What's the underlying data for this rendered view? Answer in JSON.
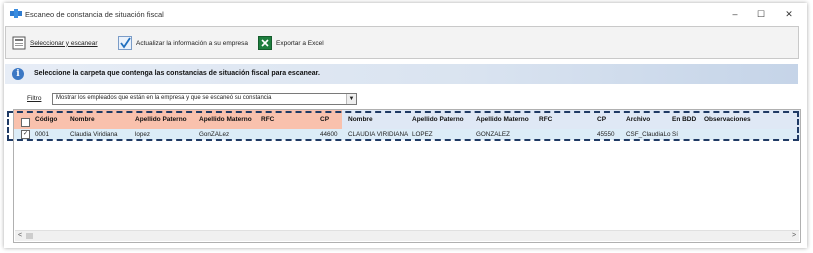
{
  "window": {
    "title": "Escaneo de constancia de situación fiscal",
    "controls": {
      "minimize": "–",
      "maximize": "☐",
      "close": "✕"
    }
  },
  "toolbar": {
    "scan_label": "Seleccionar y escanear",
    "update_label": "Actualizar la información a su empresa",
    "export_label": "Exportar a Excel"
  },
  "info": {
    "text": "Seleccione la carpeta que contenga las constancias de situación fiscal para escanear."
  },
  "filter": {
    "label": "Filtro",
    "value": "Mostrar los empleados que están en la empresa y que se escaneó su constancia"
  },
  "grid": {
    "left_headers": {
      "codigo": "Código",
      "nombre": "Nombre",
      "paterno": "Apellido Paterno",
      "materno": "Apellido Materno",
      "rfc": "RFC",
      "cp": "CP"
    },
    "right_headers": {
      "nombre": "Nombre",
      "paterno": "Apellido Paterno",
      "materno": "Apellido Materno",
      "rfc": "RFC",
      "cp": "CP",
      "archivo": "Archivo",
      "en_bdd": "En BDD",
      "observaciones": "Observaciones"
    },
    "row": {
      "checked": "✓",
      "codigo": "0001",
      "nombre": "Claudia Viridiana",
      "paterno": "lopez",
      "materno": "GonZALez",
      "rfc": "",
      "cp": "44600",
      "scan_nombre": "CLAUDIA VIRIDIANA",
      "scan_paterno": "LOPEZ",
      "scan_materno": "GONZALEZ",
      "scan_rfc": "",
      "scan_cp": "45550",
      "archivo": "CSF_ClaudiaLo",
      "en_bdd": "Sí",
      "observaciones": ""
    }
  },
  "scrollbar": {
    "left_arrow": "<",
    "right_arrow": ">"
  },
  "colors": {
    "left_header_bg": "#f9c1ad",
    "right_header_bg": "#dfe8f5",
    "row_bg": "#dcecf7",
    "selection_outline": "#1f3a64"
  }
}
